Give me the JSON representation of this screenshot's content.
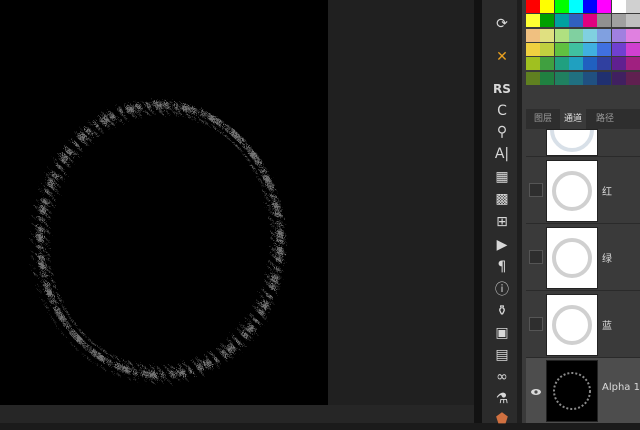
{
  "tools": [
    {
      "name": "history-icon",
      "glyph": "⟳"
    },
    {
      "name": "brushes-icon",
      "glyph": "✕"
    },
    {
      "name": "plugin-rs-icon",
      "glyph": "RS"
    },
    {
      "name": "plugin-c-icon",
      "glyph": "C"
    },
    {
      "name": "brush-tool-icon",
      "glyph": "⚲"
    },
    {
      "name": "character-icon",
      "glyph": "A|"
    },
    {
      "name": "swatch-tool-icon",
      "glyph": "▦"
    },
    {
      "name": "pattern-icon",
      "glyph": "▩"
    },
    {
      "name": "properties-icon",
      "glyph": "⊞"
    },
    {
      "name": "actions-play-icon",
      "glyph": "▶"
    },
    {
      "name": "paragraph-icon",
      "glyph": "¶"
    },
    {
      "name": "info-icon",
      "glyph": "ⓘ"
    },
    {
      "name": "clone-source-icon",
      "glyph": "⚱"
    },
    {
      "name": "layer-comps-icon",
      "glyph": "▣"
    },
    {
      "name": "notes-icon",
      "glyph": "▤"
    },
    {
      "name": "cc-libraries-icon",
      "glyph": "∞"
    },
    {
      "name": "measurement-icon",
      "glyph": "⚗"
    },
    {
      "name": "tool-presets-icon",
      "glyph": "⬟"
    }
  ],
  "swatch_colors": [
    [
      "#ff0000",
      "#ffff00",
      "#00ff00",
      "#00ffff",
      "#0000ff",
      "#ff00ff",
      "#ffffff",
      "#d0d0d0"
    ],
    [
      "#ffff33",
      "#00a000",
      "#00a0a0",
      "#3060c0",
      "#e00080",
      "#909090",
      "#a0a0a0",
      "#c0c0c0"
    ],
    [
      "#f0c080",
      "#e0e080",
      "#b0e080",
      "#80d0a0",
      "#80d0e0",
      "#80a0e0",
      "#a080e0",
      "#e080e0"
    ],
    [
      "#f0d040",
      "#c0d040",
      "#60c040",
      "#40c0a0",
      "#40b0e0",
      "#4070e0",
      "#7040d0",
      "#d040d0"
    ],
    [
      "#a0c020",
      "#40a040",
      "#20a080",
      "#20a0c0",
      "#2060c0",
      "#3040a0",
      "#602090",
      "#a02080"
    ],
    [
      "#608020",
      "#208040",
      "#208060",
      "#207080",
      "#205080",
      "#203070",
      "#402060",
      "#602050"
    ]
  ],
  "panel": {
    "tabs": [
      "图层",
      "通道",
      "路径"
    ],
    "active_tab": 1,
    "channels": [
      {
        "label": "红"
      },
      {
        "label": "绿"
      },
      {
        "label": "蓝"
      },
      {
        "label": "Alpha 1"
      }
    ]
  }
}
